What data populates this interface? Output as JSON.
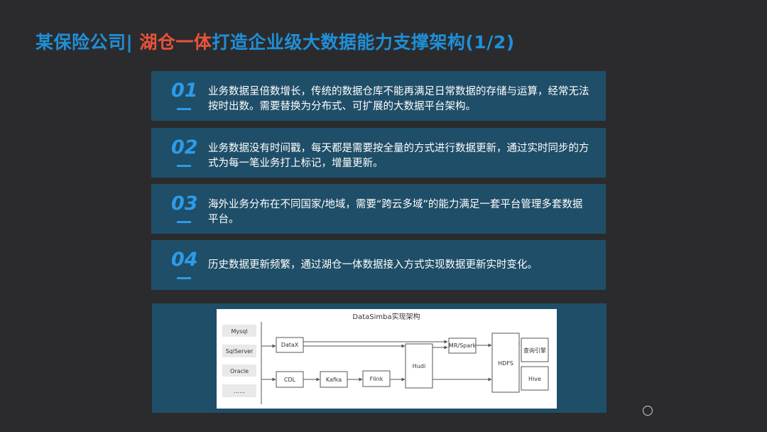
{
  "title": {
    "company": "某保险公司|",
    "highlight": "湖仓一体",
    "rest": "打造企业级大数据能力支撑架构(1/2)"
  },
  "cards": [
    {
      "num": "01",
      "text": "业务数据呈倍数增长，传统的数据仓库不能再满足日常数据的存储与运算，经常无法按时出数。需要替换为分布式、可扩展的大数据平台架构。"
    },
    {
      "num": "02",
      "text": "业务数据没有时间戳，每天都是需要按全量的方式进行数据更新，通过实时同步的方式为每一笔业务打上标记，增量更新。"
    },
    {
      "num": "03",
      "text": "海外业务分布在不同国家/地域，需要“跨云多域”的能力满足一套平台管理多套数据平台。"
    },
    {
      "num": "04",
      "text": "历史数据更新频繁，通过湖仓一体数据接入方式实现数据更新实时变化。"
    }
  ],
  "diagram": {
    "title": "DataSimba实现架构",
    "sources": [
      "Mysql",
      "SqlServer",
      "Oracle",
      "……"
    ],
    "nodes": {
      "datax": "DataX",
      "cdl": "CDL",
      "kafka": "Kafka",
      "flink": "Flink",
      "hudi": "Hudi",
      "mrspark": "MR/Spark",
      "hdfs": "HDFS",
      "query": "查询引擎",
      "hive": "Hive"
    }
  },
  "colors": {
    "background": "#2b2b2d",
    "card": "#1f4e68",
    "accent_blue": "#1f8fd6",
    "accent_red": "#e8533b",
    "number_blue": "#2d9be8"
  }
}
